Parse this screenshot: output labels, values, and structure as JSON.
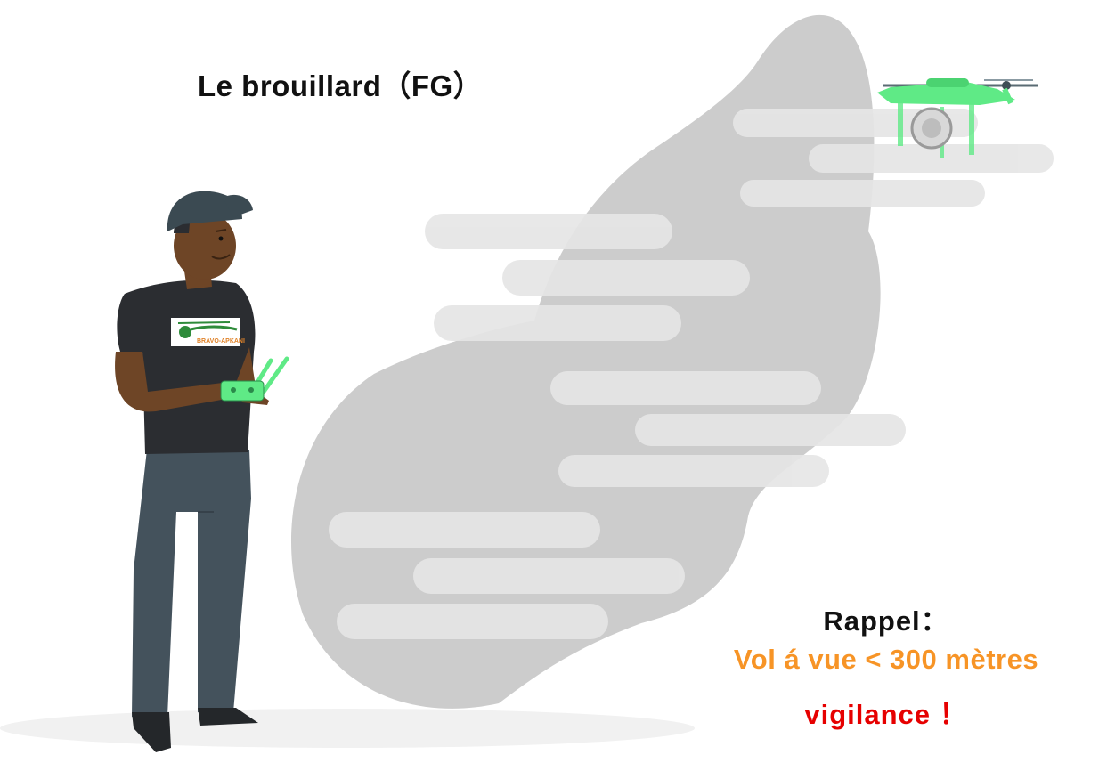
{
  "title": "Le brouillard（FG）",
  "reminder": {
    "label": "Rappel：",
    "rule": "Vol á vue < 300 mètres",
    "warning": "vigilance ！"
  },
  "shirt_logo": {
    "text": "BRAVO-APKANI"
  },
  "colors": {
    "fog": "#cccccc",
    "fog_streaks": "#e6e6e6",
    "drone": "#5fea86",
    "shirt": "#2b2d31",
    "pants": "#44525c",
    "skin": "#6e4526",
    "cap": "#3b4a52",
    "rule_orange": "#f79426",
    "warning_red": "#e60000"
  },
  "icons": [
    "drone-icon",
    "remote-controller-icon",
    "fog-cloud-icon",
    "pilot-figure"
  ]
}
